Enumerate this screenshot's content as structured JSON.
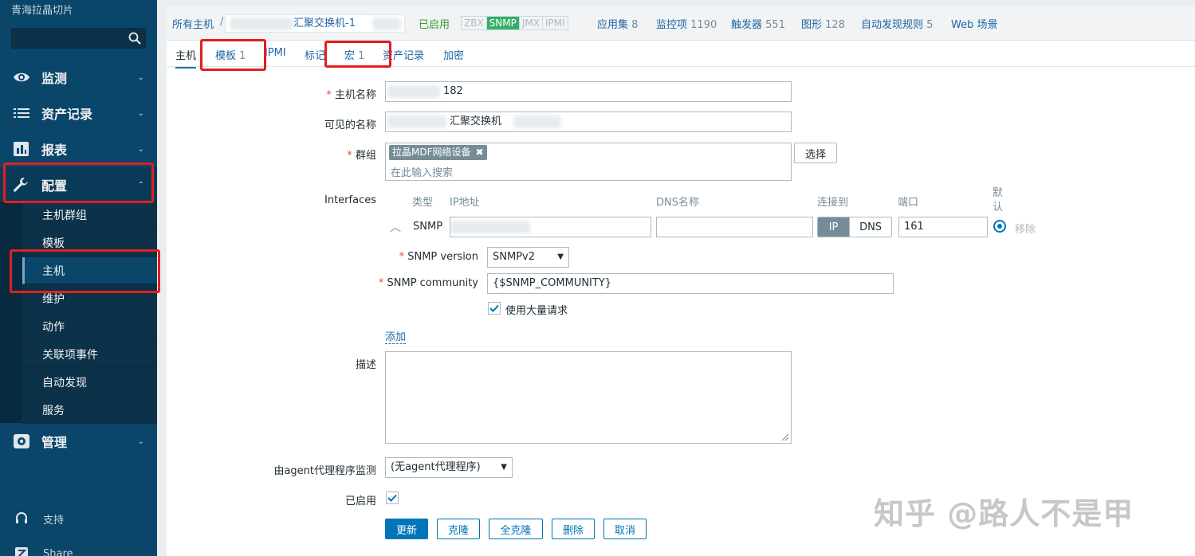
{
  "sidebar": {
    "brand": "青海拉晶切片",
    "search_placeholder": "",
    "menu": [
      {
        "label": "监测",
        "icon": "eye-icon"
      },
      {
        "label": "资产记录",
        "icon": "list-icon"
      },
      {
        "label": "报表",
        "icon": "bar-chart-icon"
      },
      {
        "label": "配置",
        "icon": "wrench-icon"
      },
      {
        "label": "管理",
        "icon": "gear-icon"
      }
    ],
    "submenu": [
      "主机群组",
      "模板",
      "主机",
      "维护",
      "动作",
      "关联项事件",
      "自动发现",
      "服务"
    ],
    "footer": [
      {
        "label": "支持",
        "icon": "headset-icon"
      },
      {
        "label": "Share",
        "icon": "share-icon"
      }
    ]
  },
  "header": {
    "all_hosts": "所有主机",
    "separator": "/",
    "host_name": "汇聚交换机-1",
    "enabled": "已启用",
    "availability": [
      "ZBX",
      "SNMP",
      "JMX",
      "IPMI"
    ],
    "links": [
      {
        "label": "应用集",
        "count": "8"
      },
      {
        "label": "监控项",
        "count": "1190"
      },
      {
        "label": "触发器",
        "count": "551"
      },
      {
        "label": "图形",
        "count": "128"
      },
      {
        "label": "自动发现规则",
        "count": "5"
      },
      {
        "label": "Web 场景",
        "count": ""
      }
    ]
  },
  "tabs": [
    {
      "label": "主机",
      "count": ""
    },
    {
      "label": "模板",
      "count": "1"
    },
    {
      "label": "IPMI",
      "count": ""
    },
    {
      "label": "标记",
      "count": ""
    },
    {
      "label": "宏",
      "count": "1"
    },
    {
      "label": "资产记录",
      "count": ""
    },
    {
      "label": "加密",
      "count": ""
    }
  ],
  "form": {
    "host_name_label": "主机名称",
    "host_name_value": "182",
    "visible_name_label": "可见的名称",
    "visible_name_value": "汇聚交换机",
    "groups_label": "群组",
    "group_chip": "拉晶MDF网络设备",
    "groups_placeholder": "在此输入搜索",
    "select_button": "选择",
    "interfaces_label": "Interfaces",
    "col_type": "类型",
    "col_ip": "IP地址",
    "col_dns": "DNS名称",
    "col_connect": "连接到",
    "col_port": "端口",
    "col_default": "默认",
    "iface_type": "SNMP",
    "iface_ip": "",
    "iface_dns": "",
    "connect_ip": "IP",
    "connect_dns": "DNS",
    "port": "161",
    "remove": "移除",
    "snmp_version_label": "SNMP version",
    "snmp_version_value": "SNMPv2",
    "snmp_community_label": "SNMP community",
    "snmp_community_value": "{$SNMP_COMMUNITY}",
    "bulk_label": "使用大量请求",
    "add_link": "添加",
    "description_label": "描述",
    "proxy_label": "由agent代理程序监测",
    "proxy_value": "(无agent代理程序)",
    "enabled_label": "已启用"
  },
  "buttons": {
    "update": "更新",
    "clone": "克隆",
    "full_clone": "全克隆",
    "delete": "删除",
    "cancel": "取消"
  },
  "watermark": "知乎 @路人不是甲",
  "colors": {
    "sidebar": "#0a466a",
    "accent": "#0275b8",
    "highlight": "#e21e1e",
    "snmp": "#34af67"
  }
}
